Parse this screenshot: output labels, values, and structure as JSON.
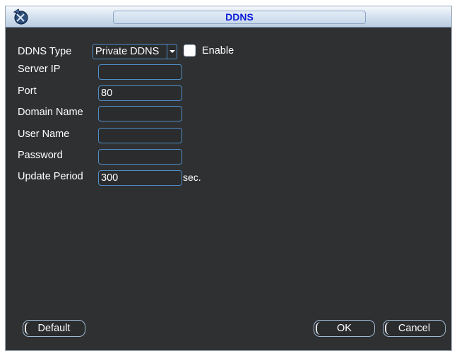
{
  "window": {
    "title": "DDNS"
  },
  "form": {
    "ddns_type_label": "DDNS Type",
    "ddns_type_value": "Private DDNS",
    "enable_label": "Enable",
    "enable_checked": false,
    "server_ip_label": "Server IP",
    "server_ip_value": "",
    "port_label": "Port",
    "port_value": "80",
    "domain_name_label": "Domain Name",
    "domain_name_value": "",
    "user_name_label": "User Name",
    "user_name_value": "",
    "password_label": "Password",
    "password_value": "",
    "update_period_label": "Update Period",
    "update_period_value": "300",
    "update_period_unit": "sec."
  },
  "buttons": {
    "default_label": "Default",
    "ok_label": "OK",
    "cancel_label": "Cancel"
  },
  "colors": {
    "title_text": "#0b1bd8",
    "panel_bg": "#2f3031",
    "field_border": "#4f8ec9",
    "titlebar_start": "#f4f8fc",
    "titlebar_end": "#b9cde2"
  }
}
